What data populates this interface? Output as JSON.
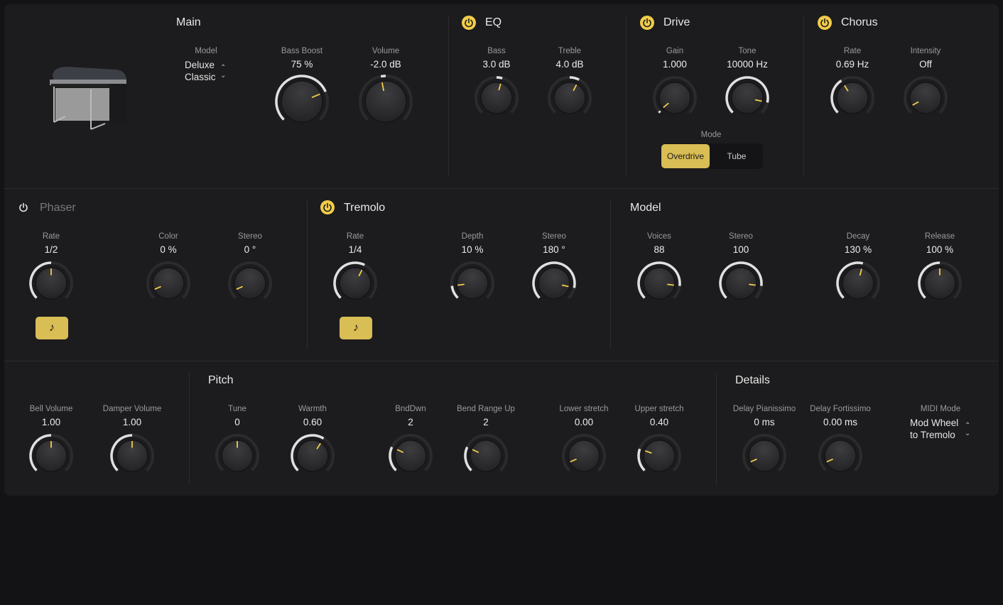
{
  "colors": {
    "accent": "#f2cd4a",
    "panel": "#1c1c1e",
    "arc": "#e0e0e0",
    "indicator": "#f2cd4a"
  },
  "main": {
    "title": "Main",
    "model_label": "Model",
    "model_value_line1": "Deluxe",
    "model_value_line2": "Classic",
    "knobs": {
      "bass_boost": {
        "label": "Bass Boost",
        "value": "75 %",
        "pos": 0.75,
        "bipolar": false
      },
      "volume": {
        "label": "Volume",
        "value": "-2.0 dB",
        "pos": 0.46,
        "bipolar": true
      }
    }
  },
  "eq": {
    "title": "EQ",
    "enabled": true,
    "knobs": {
      "bass": {
        "label": "Bass",
        "value": "3.0 dB",
        "pos": 0.56,
        "bipolar": true
      },
      "treble": {
        "label": "Treble",
        "value": "4.0 dB",
        "pos": 0.6,
        "bipolar": true
      }
    }
  },
  "drive": {
    "title": "Drive",
    "enabled": true,
    "mode_label": "Mode",
    "modes": [
      "Overdrive",
      "Tube"
    ],
    "mode_selected": "Overdrive",
    "knobs": {
      "gain": {
        "label": "Gain",
        "value": "1.000",
        "pos": 0.02,
        "bipolar": false
      },
      "tone": {
        "label": "Tone",
        "value": "10000 Hz",
        "pos": 0.88,
        "bipolar": false
      }
    }
  },
  "chorus": {
    "title": "Chorus",
    "enabled": true,
    "knobs": {
      "rate": {
        "label": "Rate",
        "value": "0.69 Hz",
        "pos": 0.38,
        "bipolar": false
      },
      "intensity": {
        "label": "Intensity",
        "value": "Off",
        "pos": 0.06,
        "bipolar": false,
        "noarc": true
      }
    }
  },
  "phaser": {
    "title": "Phaser",
    "enabled": false,
    "knobs": {
      "rate": {
        "label": "Rate",
        "value": "1/2",
        "pos": 0.5,
        "bipolar": false
      },
      "color": {
        "label": "Color",
        "value": "0 %",
        "pos": 0.08,
        "noarc": true
      },
      "stereo": {
        "label": "Stereo",
        "value": "0 °",
        "pos": 0.08,
        "noarc": true
      }
    }
  },
  "tremolo": {
    "title": "Tremolo",
    "enabled": true,
    "knobs": {
      "rate": {
        "label": "Rate",
        "value": "1/4",
        "pos": 0.6,
        "bipolar": false
      },
      "depth": {
        "label": "Depth",
        "value": "10 %",
        "pos": 0.14,
        "bipolar": false
      },
      "stereo": {
        "label": "Stereo",
        "value": "180 °",
        "pos": 0.88,
        "bipolar": false
      }
    }
  },
  "model": {
    "title": "Model",
    "knobs": {
      "voices": {
        "label": "Voices",
        "value": "88",
        "pos": 0.86
      },
      "stereo": {
        "label": "Stereo",
        "value": "100",
        "pos": 0.86
      },
      "decay": {
        "label": "Decay",
        "value": "130 %",
        "pos": 0.55
      },
      "release": {
        "label": "Release",
        "value": "100 %",
        "pos": 0.5
      }
    }
  },
  "misc": {
    "knobs": {
      "bell_volume": {
        "label": "Bell Volume",
        "value": "1.00",
        "pos": 0.5
      },
      "damper_volume": {
        "label": "Damper Volume",
        "value": "1.00",
        "pos": 0.5
      }
    }
  },
  "pitch": {
    "title": "Pitch",
    "knobs": {
      "tune": {
        "label": "Tune",
        "value": "0",
        "pos": 0.5,
        "noarc": true
      },
      "warmth": {
        "label": "Warmth",
        "value": "0.60",
        "pos": 0.62
      },
      "bnddwn": {
        "label": "BndDwn",
        "value": "2",
        "pos": 0.26
      },
      "bend_up": {
        "label": "Bend Range Up",
        "value": "2",
        "pos": 0.26
      },
      "lower_stretch": {
        "label": "Lower stretch",
        "value": "0.00",
        "pos": 0.08,
        "noarc": true
      },
      "upper_stretch": {
        "label": "Upper stretch",
        "value": "0.40",
        "pos": 0.24
      }
    }
  },
  "details": {
    "title": "Details",
    "midi_mode_label": "MIDI Mode",
    "midi_mode_line1": "Mod Wheel",
    "midi_mode_line2": "to Tremolo",
    "knobs": {
      "delay_pp": {
        "label": "Delay Pianissimo",
        "value": "0 ms",
        "pos": 0.08,
        "noarc": true
      },
      "delay_ff": {
        "label": "Delay Fortissimo",
        "value": "0.00 ms",
        "pos": 0.08,
        "noarc": true
      }
    }
  },
  "icons": {
    "power": "power-icon",
    "sync": "note-icon",
    "stepper": "up-down-chevron-icon",
    "note_glyph": "♪",
    "stepper_glyph": "⌃⌄"
  }
}
